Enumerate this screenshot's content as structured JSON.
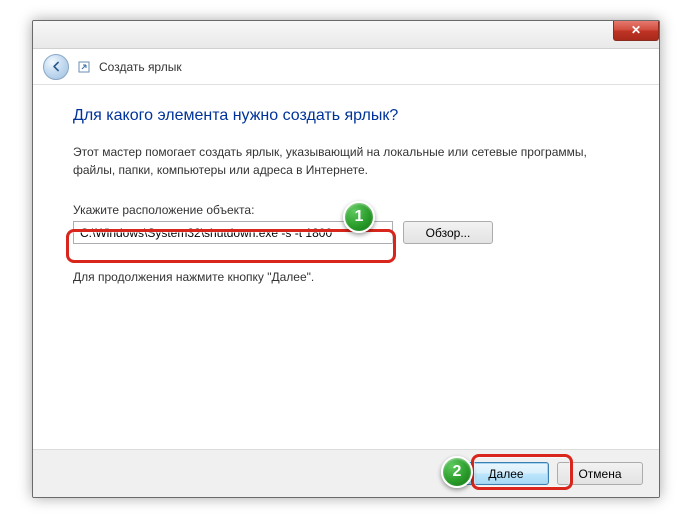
{
  "titlebar": {
    "close_glyph": "✕"
  },
  "header": {
    "back_aria": "Назад",
    "title": "Создать ярлык"
  },
  "main": {
    "heading": "Для какого элемента нужно создать ярлык?",
    "description": "Этот мастер помогает создать ярлык, указывающий на локальные или сетевые программы, файлы, папки, компьютеры или адреса в Интернете.",
    "field_label": "Укажите расположение объекта:",
    "location_value": "C:\\Windows\\System32\\shutdown.exe -s -t 1800",
    "browse_label": "Обзор...",
    "hint": "Для продолжения нажмите кнопку \"Далее\"."
  },
  "footer": {
    "next_label": "Далее",
    "cancel_label": "Отмена"
  },
  "annotations": {
    "badge1": "1",
    "badge2": "2"
  }
}
